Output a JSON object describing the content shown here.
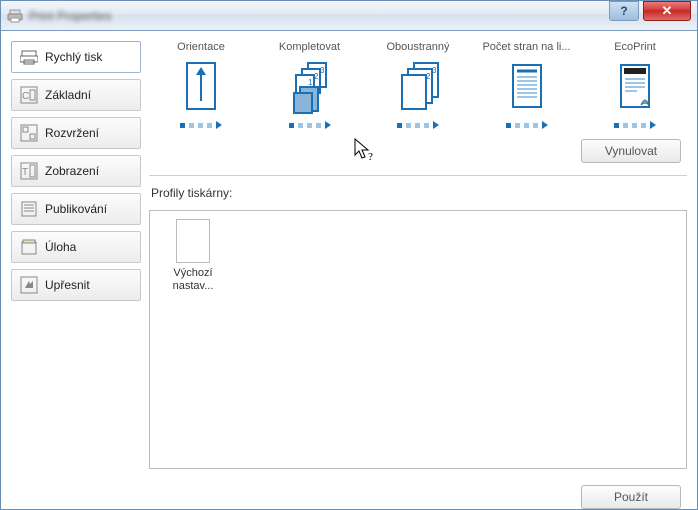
{
  "window": {
    "title": "Print Properties"
  },
  "sidebar": {
    "tabs": [
      {
        "id": "quick",
        "label": "Rychlý tisk",
        "icon": "printer-quick-icon",
        "active": true
      },
      {
        "id": "basic",
        "label": "Základní",
        "icon": "basic-icon",
        "active": false
      },
      {
        "id": "layout",
        "label": "Rozvržení",
        "icon": "layout-icon",
        "active": false
      },
      {
        "id": "display",
        "label": "Zobrazení",
        "icon": "display-icon",
        "active": false
      },
      {
        "id": "publish",
        "label": "Publikování",
        "icon": "publish-icon",
        "active": false
      },
      {
        "id": "job",
        "label": "Úloha",
        "icon": "job-icon",
        "active": false
      },
      {
        "id": "advanced",
        "label": "Upřesnit",
        "icon": "advanced-icon",
        "active": false
      }
    ]
  },
  "quick": {
    "items": [
      {
        "id": "orientation",
        "label": "Orientace",
        "current": 0,
        "total": 4
      },
      {
        "id": "collate",
        "label": "Kompletovat",
        "current": 0,
        "total": 4
      },
      {
        "id": "duplex",
        "label": "Oboustranný",
        "current": 0,
        "total": 4
      },
      {
        "id": "nup",
        "label": "Počet stran na li...",
        "current": 0,
        "total": 4
      },
      {
        "id": "ecoprint",
        "label": "EcoPrint",
        "current": 0,
        "total": 4
      }
    ],
    "reset_label": "Vynulovat"
  },
  "profiles": {
    "title": "Profily tiskárny:",
    "items": [
      {
        "name": "Výchozí nastav..."
      }
    ]
  },
  "footer": {
    "apply_label": "Použít"
  },
  "colors": {
    "accent": "#1b6fb5",
    "accent_light": "#9dc6e6"
  }
}
